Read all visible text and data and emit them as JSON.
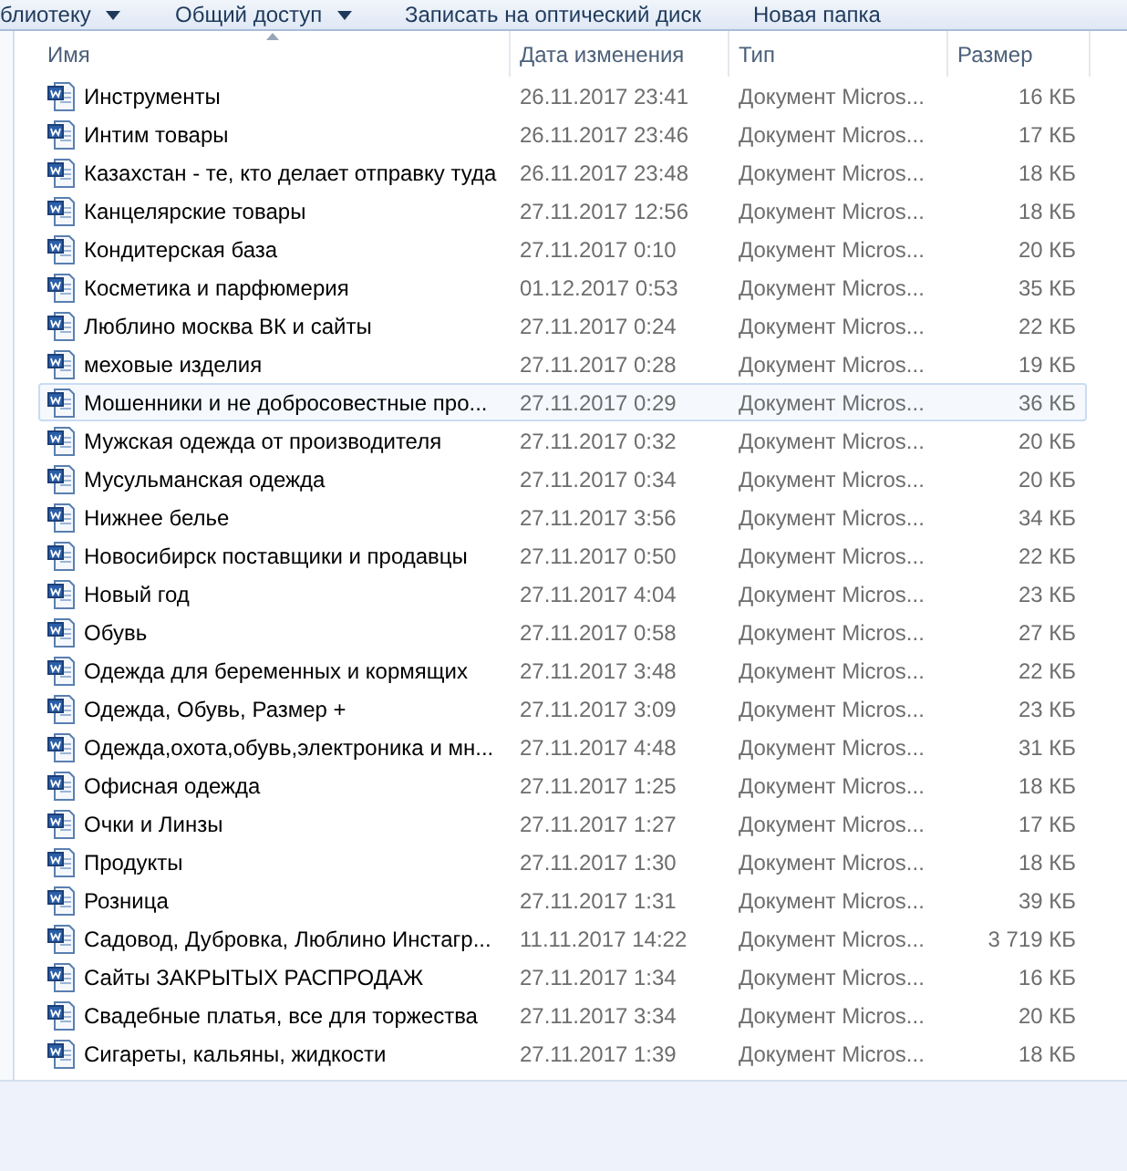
{
  "toolbar": [
    {
      "label": "блиотеку",
      "dropdown": true
    },
    {
      "label": "Общий доступ",
      "dropdown": true
    },
    {
      "label": "Записать на оптический диск",
      "dropdown": false
    },
    {
      "label": "Новая папка",
      "dropdown": false
    }
  ],
  "columns": [
    "Имя",
    "Дата изменения",
    "Тип",
    "Размер"
  ],
  "rows": [
    {
      "name": "Инструменты",
      "date": "26.11.2017 23:41",
      "type": "Документ Micros...",
      "size": "16 КБ",
      "selected": false
    },
    {
      "name": "Интим товары",
      "date": "26.11.2017 23:46",
      "type": "Документ Micros...",
      "size": "17 КБ",
      "selected": false
    },
    {
      "name": "Казахстан - те, кто делает отправку туда",
      "date": "26.11.2017 23:48",
      "type": "Документ Micros...",
      "size": "18 КБ",
      "selected": false
    },
    {
      "name": "Канцелярские товары",
      "date": "27.11.2017 12:56",
      "type": "Документ Micros...",
      "size": "18 КБ",
      "selected": false
    },
    {
      "name": "Кондитерская база",
      "date": "27.11.2017 0:10",
      "type": "Документ Micros...",
      "size": "20 КБ",
      "selected": false
    },
    {
      "name": "Косметика и парфюмерия",
      "date": "01.12.2017 0:53",
      "type": "Документ Micros...",
      "size": "35 КБ",
      "selected": false
    },
    {
      "name": "Люблино москва  ВК и сайты",
      "date": "27.11.2017 0:24",
      "type": "Документ Micros...",
      "size": "22 КБ",
      "selected": false
    },
    {
      "name": "меховые изделия",
      "date": "27.11.2017 0:28",
      "type": "Документ Micros...",
      "size": "19 КБ",
      "selected": false
    },
    {
      "name": "Мошенники и не добросовестные про...",
      "date": "27.11.2017 0:29",
      "type": "Документ Micros...",
      "size": "36 КБ",
      "selected": true
    },
    {
      "name": "Мужская одежда от производителя",
      "date": "27.11.2017 0:32",
      "type": "Документ Micros...",
      "size": "20 КБ",
      "selected": false
    },
    {
      "name": "Мусульманская одежда",
      "date": "27.11.2017 0:34",
      "type": "Документ Micros...",
      "size": "20 КБ",
      "selected": false
    },
    {
      "name": "Нижнее белье",
      "date": "27.11.2017 3:56",
      "type": "Документ Micros...",
      "size": "34 КБ",
      "selected": false
    },
    {
      "name": "Новосибирск поставщики и продавцы",
      "date": "27.11.2017 0:50",
      "type": "Документ Micros...",
      "size": "22 КБ",
      "selected": false
    },
    {
      "name": "Новый год",
      "date": "27.11.2017 4:04",
      "type": "Документ Micros...",
      "size": "23 КБ",
      "selected": false
    },
    {
      "name": "Обувь",
      "date": "27.11.2017 0:58",
      "type": "Документ Micros...",
      "size": "27 КБ",
      "selected": false
    },
    {
      "name": "Одежда для беременных и кормящих",
      "date": "27.11.2017 3:48",
      "type": "Документ Micros...",
      "size": "22 КБ",
      "selected": false
    },
    {
      "name": "Одежда, Обувь, Размер +",
      "date": "27.11.2017 3:09",
      "type": "Документ Micros...",
      "size": "23 КБ",
      "selected": false
    },
    {
      "name": "Одежда,охота,обувь,электроника и мн...",
      "date": "27.11.2017 4:48",
      "type": "Документ Micros...",
      "size": "31 КБ",
      "selected": false
    },
    {
      "name": "Офисная одежда",
      "date": "27.11.2017 1:25",
      "type": "Документ Micros...",
      "size": "18 КБ",
      "selected": false
    },
    {
      "name": "Очки и Линзы",
      "date": "27.11.2017 1:27",
      "type": "Документ Micros...",
      "size": "17 КБ",
      "selected": false
    },
    {
      "name": "Продукты",
      "date": "27.11.2017 1:30",
      "type": "Документ Micros...",
      "size": "18 КБ",
      "selected": false
    },
    {
      "name": "Розница",
      "date": "27.11.2017 1:31",
      "type": "Документ Micros...",
      "size": "39 КБ",
      "selected": false
    },
    {
      "name": "Садовод, Дубровка, Люблино Инстагр...",
      "date": "11.11.2017 14:22",
      "type": "Документ Micros...",
      "size": "3 719 КБ",
      "selected": false
    },
    {
      "name": "Сайты ЗАКРЫТЫХ РАСПРОДАЖ",
      "date": "27.11.2017 1:34",
      "type": "Документ Micros...",
      "size": "16 КБ",
      "selected": false
    },
    {
      "name": "Свадебные платья, все для торжества",
      "date": "27.11.2017 3:34",
      "type": "Документ Micros...",
      "size": "20 КБ",
      "selected": false
    },
    {
      "name": "Сигареты, кальяны, жидкости",
      "date": "27.11.2017 1:39",
      "type": "Документ Micros...",
      "size": "18 КБ",
      "selected": false
    }
  ]
}
